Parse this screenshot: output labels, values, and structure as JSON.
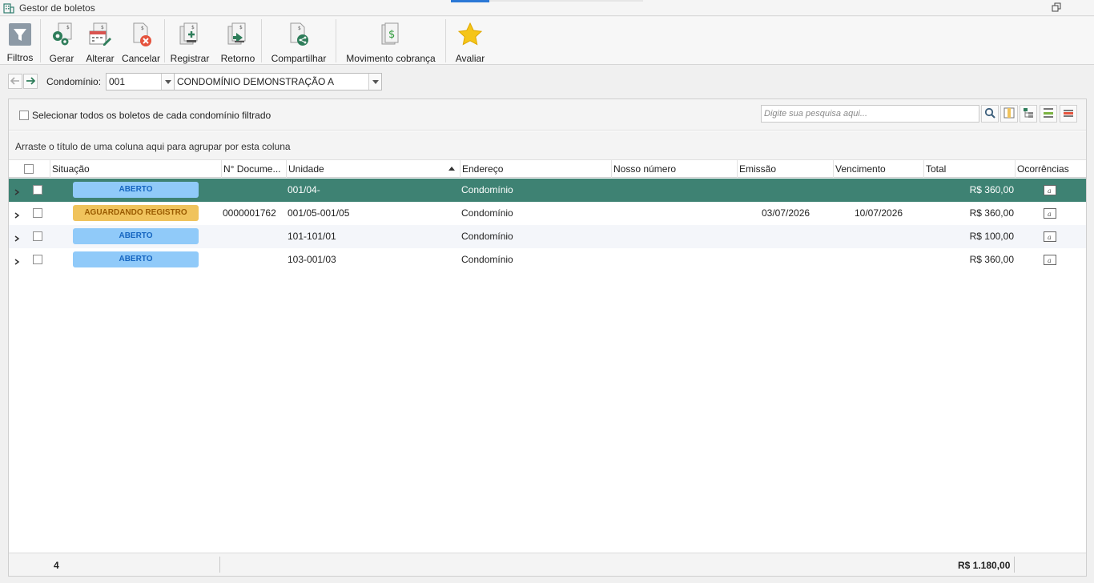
{
  "window": {
    "title": "Gestor de boletos"
  },
  "toolbar": {
    "buttons": [
      {
        "label": "Filtros",
        "icon": "filter-icon"
      },
      {
        "label": "Gerar",
        "icon": "gears-icon"
      },
      {
        "label": "Alterar",
        "icon": "calendar-edit-icon"
      },
      {
        "label": "Cancelar",
        "icon": "cancel-document-icon"
      },
      {
        "label": "Registrar",
        "icon": "register-document-icon"
      },
      {
        "label": "Retorno",
        "icon": "return-document-icon"
      },
      {
        "label": "Compartilhar",
        "icon": "share-icon"
      },
      {
        "label": "Movimento cobrança",
        "icon": "money-document-icon"
      },
      {
        "label": "Avaliar",
        "icon": "star-icon"
      }
    ]
  },
  "filter": {
    "condominio_label": "Condomínio:",
    "condominio_code": "001",
    "condominio_name": "CONDOMÍNIO DEMONSTRAÇÃO A"
  },
  "grid": {
    "select_all_label": "Selecionar todos os boletos de cada condomínio filtrado",
    "search_placeholder": "Digite sua pesquisa aqui...",
    "group_hint": "Arraste o título de uma coluna aqui para agrupar por esta coluna",
    "columns": [
      "Situação",
      "N° Documento",
      "Unidade",
      "Endereço",
      "Nosso número",
      "Emissão",
      "Vencimento",
      "Total",
      "Ocorrências"
    ],
    "columns_display": [
      "Situação",
      "N° Docume...",
      "Unidade",
      "Endereço",
      "Nosso número",
      "Emissão",
      "Vencimento",
      "Total",
      "Ocorrências"
    ],
    "rows": [
      {
        "situacao": "ABERTO",
        "status_type": "aberto",
        "documento": "",
        "unidade": "001/04-",
        "endereco": "Condomínio",
        "nosso_numero": "",
        "emissao": "",
        "vencimento": "",
        "total": "R$ 360,00"
      },
      {
        "situacao": "AGUARDANDO REGISTRO",
        "status_type": "aguard",
        "documento": "0000001762",
        "unidade": "001/05-001/05",
        "endereco": "Condomínio",
        "nosso_numero": "",
        "emissao": "03/07/2026",
        "vencimento": "10/07/2026",
        "total": "R$ 360,00"
      },
      {
        "situacao": "ABERTO",
        "status_type": "aberto",
        "documento": "",
        "unidade": "101-101/01",
        "endereco": "Condomínio",
        "nosso_numero": "",
        "emissao": "",
        "vencimento": "",
        "total": "R$ 100,00"
      },
      {
        "situacao": "ABERTO",
        "status_type": "aberto",
        "documento": "",
        "unidade": "103-001/03",
        "endereco": "Condomínio",
        "nosso_numero": "",
        "emissao": "",
        "vencimento": "",
        "total": "R$ 360,00"
      }
    ],
    "footer": {
      "count": "4",
      "sum_total": "R$ 1.180,00"
    }
  },
  "colors": {
    "selected_row": "#3e8273",
    "badge_aberto": "#90caf9",
    "badge_aguardando": "#f0c35c",
    "accent": "#2b78d6"
  }
}
